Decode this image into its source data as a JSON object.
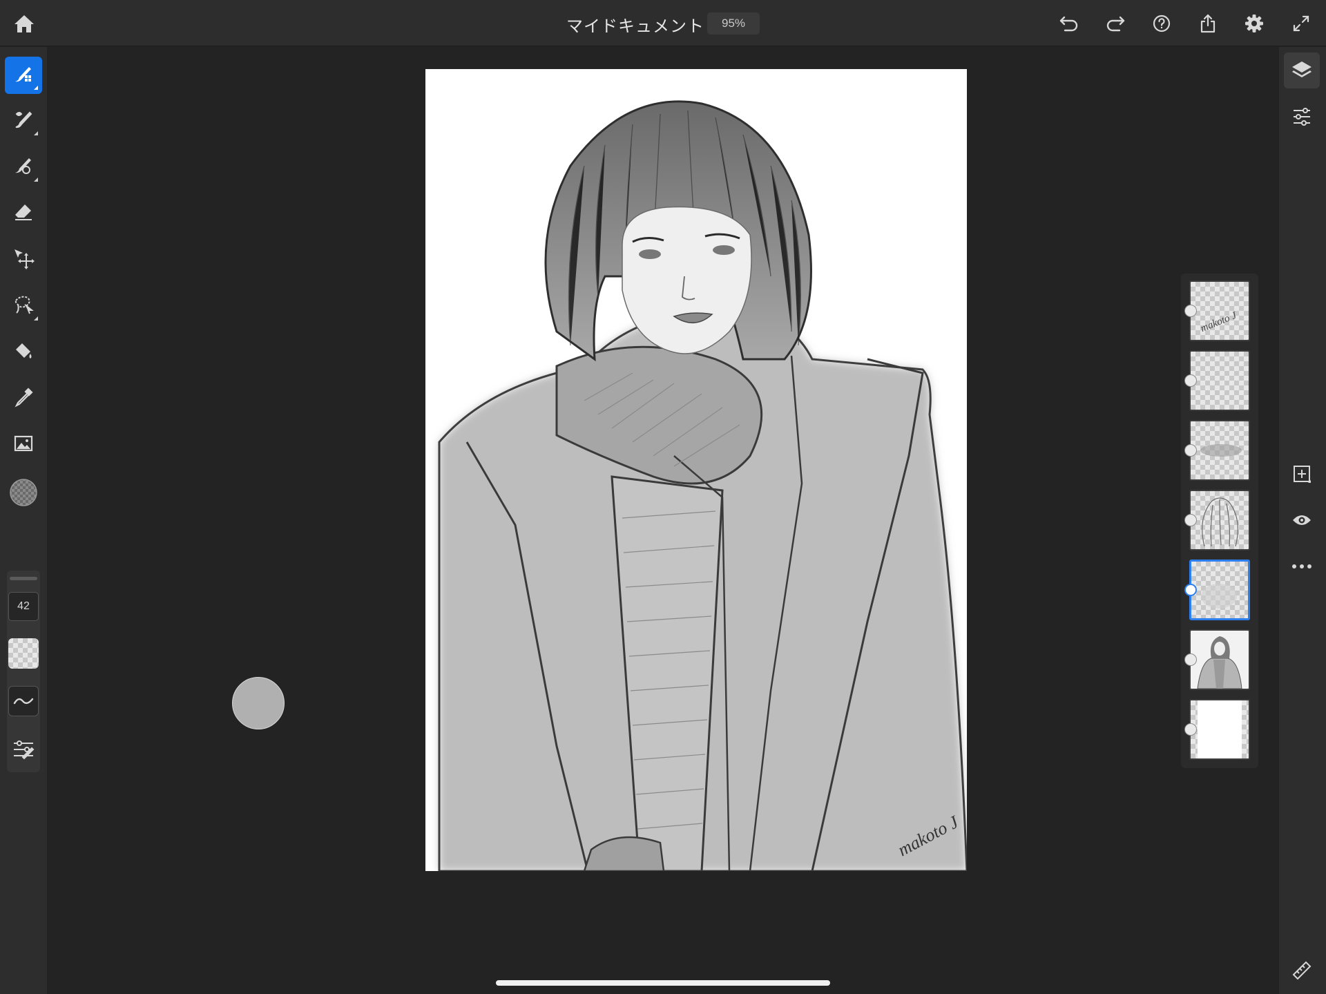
{
  "header": {
    "document_title": "マイドキュメント",
    "zoom": "95%"
  },
  "toolbar": {
    "icons": [
      "home-icon",
      "undo-icon",
      "redo-icon",
      "help-icon",
      "share-icon",
      "settings-icon",
      "fullscreen-icon"
    ]
  },
  "tools": [
    {
      "name": "pixel-brush-tool-icon",
      "active": true
    },
    {
      "name": "live-brush-tool-icon",
      "active": false
    },
    {
      "name": "vector-brush-tool-icon",
      "active": false
    },
    {
      "name": "eraser-tool-icon",
      "active": false
    },
    {
      "name": "transform-tool-icon",
      "active": false
    },
    {
      "name": "selection-tool-icon",
      "active": false
    },
    {
      "name": "fill-tool-icon",
      "active": false
    },
    {
      "name": "eyedropper-tool-icon",
      "active": false
    },
    {
      "name": "image-tool-icon",
      "active": false
    },
    {
      "name": "color-swatch-icon",
      "active": false
    }
  ],
  "brush_properties": {
    "size": "42",
    "icons": [
      "opacity-icon",
      "smoothing-icon",
      "brush-settings-icon"
    ]
  },
  "right_rail": {
    "icons": [
      "layers-icon",
      "layer-properties-icon",
      "add-layer-icon",
      "visibility-icon",
      "more-icon",
      "ruler-icon"
    ]
  },
  "layers": [
    {
      "id": "signature",
      "selected": false,
      "signature_text": "makoto J"
    },
    {
      "id": "empty",
      "selected": false
    },
    {
      "id": "lips",
      "selected": false
    },
    {
      "id": "hair-lines",
      "selected": false
    },
    {
      "id": "shading",
      "selected": true
    },
    {
      "id": "sketch",
      "selected": false
    },
    {
      "id": "background",
      "selected": false
    }
  ],
  "canvas": {
    "signature": "makoto J"
  },
  "colors": {
    "accent": "#1473e6",
    "selection": "#2d7ff0",
    "background": "#232323",
    "panel": "#2d2d2d"
  }
}
